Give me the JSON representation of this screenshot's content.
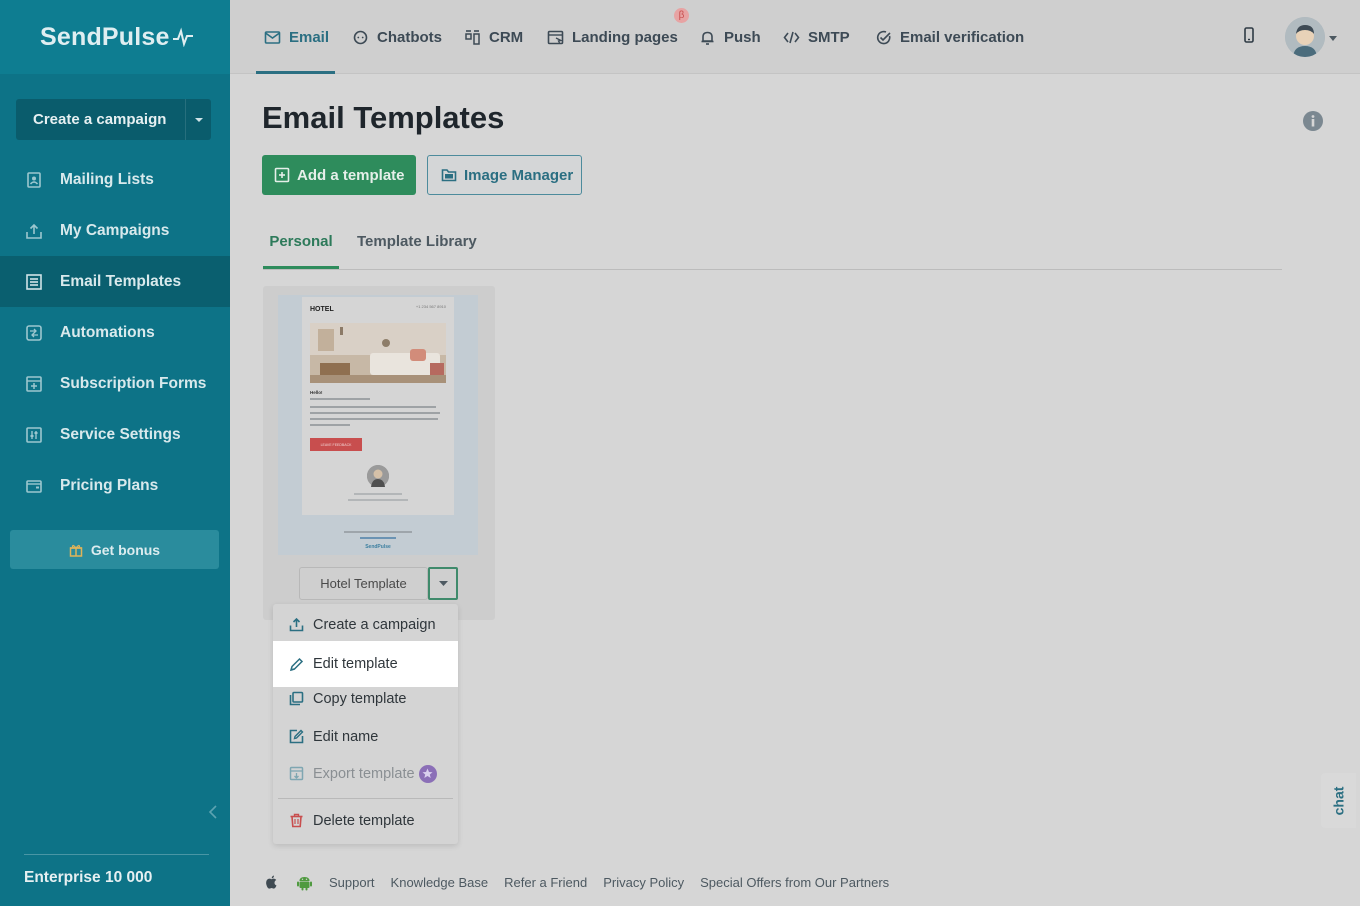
{
  "brand": {
    "name": "SendPulse"
  },
  "sidebar": {
    "create_label": "Create a campaign",
    "items": [
      {
        "label": "Mailing Lists",
        "icon": "address-book-icon"
      },
      {
        "label": "My Campaigns",
        "icon": "campaign-send-icon"
      },
      {
        "label": "Email Templates",
        "icon": "templates-icon",
        "active": true
      },
      {
        "label": "Automations",
        "icon": "automation-icon"
      },
      {
        "label": "Subscription Forms",
        "icon": "form-icon"
      },
      {
        "label": "Service Settings",
        "icon": "settings-sliders-icon"
      },
      {
        "label": "Pricing Plans",
        "icon": "wallet-icon"
      }
    ],
    "bonus_label": "Get bonus",
    "plan_label": "Enterprise 10 000"
  },
  "topnav": {
    "tabs": [
      {
        "label": "Email",
        "icon": "envelope-icon",
        "active": true
      },
      {
        "label": "Chatbots",
        "icon": "chat-bubble-icon"
      },
      {
        "label": "CRM",
        "icon": "kanban-icon"
      },
      {
        "label": "Landing pages",
        "icon": "landing-page-icon"
      },
      {
        "label": "Push",
        "icon": "bell-icon"
      },
      {
        "label": "SMTP",
        "icon": "code-icon"
      },
      {
        "label": "Email verification",
        "icon": "check-circle-icon"
      }
    ],
    "beta_badge": "β"
  },
  "main": {
    "title": "Email Templates",
    "add_template_label": "Add a template",
    "image_manager_label": "Image Manager",
    "subtabs": [
      {
        "label": "Personal",
        "active": true
      },
      {
        "label": "Template Library"
      }
    ]
  },
  "template_card": {
    "name": "Hotel Template",
    "preview": {
      "heading": "HOTEL",
      "phone": "+1 234 567 8910",
      "greeting": "Hello!",
      "button": "LEAVE FEEDBACK",
      "brand": "SendPulse"
    }
  },
  "dropdown": {
    "items": [
      {
        "label": "Create a campaign",
        "icon": "campaign-send-icon"
      },
      {
        "label": "Edit template",
        "icon": "pencil-icon"
      },
      {
        "label": "Copy template",
        "icon": "copy-icon"
      },
      {
        "label": "Edit name",
        "icon": "edit-square-icon"
      },
      {
        "label": "Export template",
        "icon": "export-icon",
        "disabled": true
      },
      {
        "label": "Delete template",
        "icon": "trash-icon"
      }
    ]
  },
  "chat": {
    "label": "chat"
  },
  "footer": {
    "links": [
      "Support",
      "Knowledge Base",
      "Refer a Friend",
      "Privacy Policy",
      "Special Offers from Our Partners"
    ]
  },
  "colors": {
    "sidebar_bg": "#0d7387",
    "accent_green": "#2e8c5c",
    "accent_teal": "#2b6f82",
    "delete_red": "#c84e4e",
    "pro_purple": "#8b6fb7"
  }
}
